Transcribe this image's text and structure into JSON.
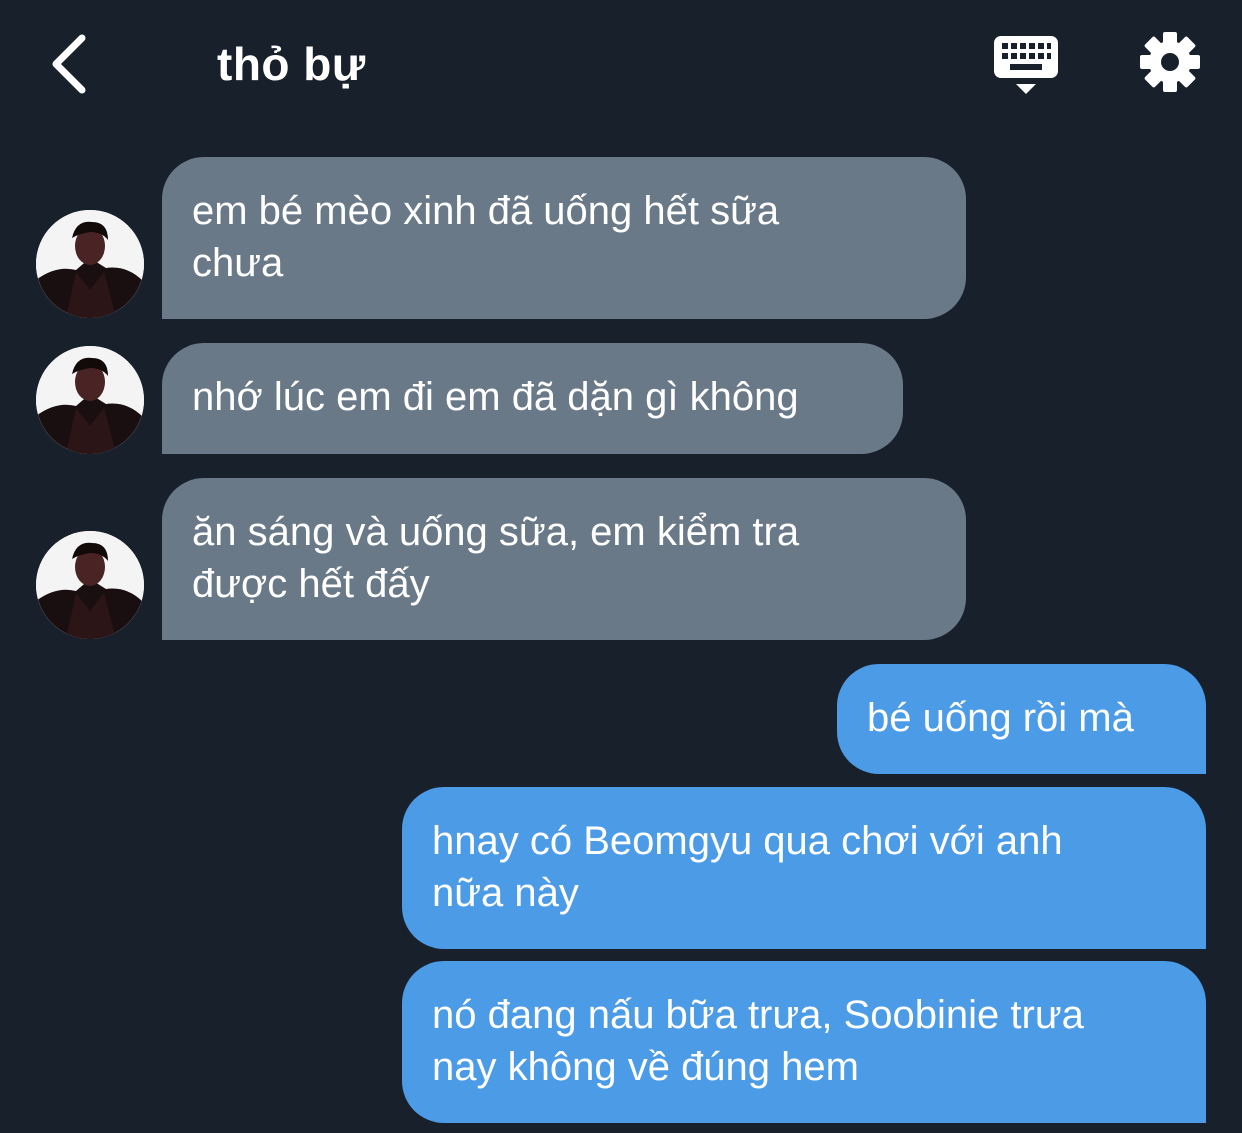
{
  "header": {
    "title": "thỏ bự"
  },
  "messages": [
    {
      "direction": "incoming",
      "text": "em bé mèo xinh đã uống hết sữa\nchưa"
    },
    {
      "direction": "incoming",
      "text": "nhớ lúc em đi em đã dặn gì không"
    },
    {
      "direction": "incoming",
      "text": "ăn sáng và uống sữa, em kiểm tra\nđược hết đấy"
    },
    {
      "direction": "outgoing",
      "text": "bé uống rồi mà"
    },
    {
      "direction": "outgoing",
      "text": "hnay có Beomgyu qua chơi với anh\nnữa này"
    },
    {
      "direction": "outgoing",
      "text": "nó đang nấu bữa trưa, Soobinie trưa\nnay không về đúng hem"
    }
  ],
  "colors": {
    "background": "#18202b",
    "incoming_bubble": "#6a7988",
    "outgoing_bubble": "#4c9be6"
  },
  "icons": {
    "back": "chevron-left-icon",
    "keyboard": "keyboard-icon",
    "settings": "gear-icon"
  }
}
